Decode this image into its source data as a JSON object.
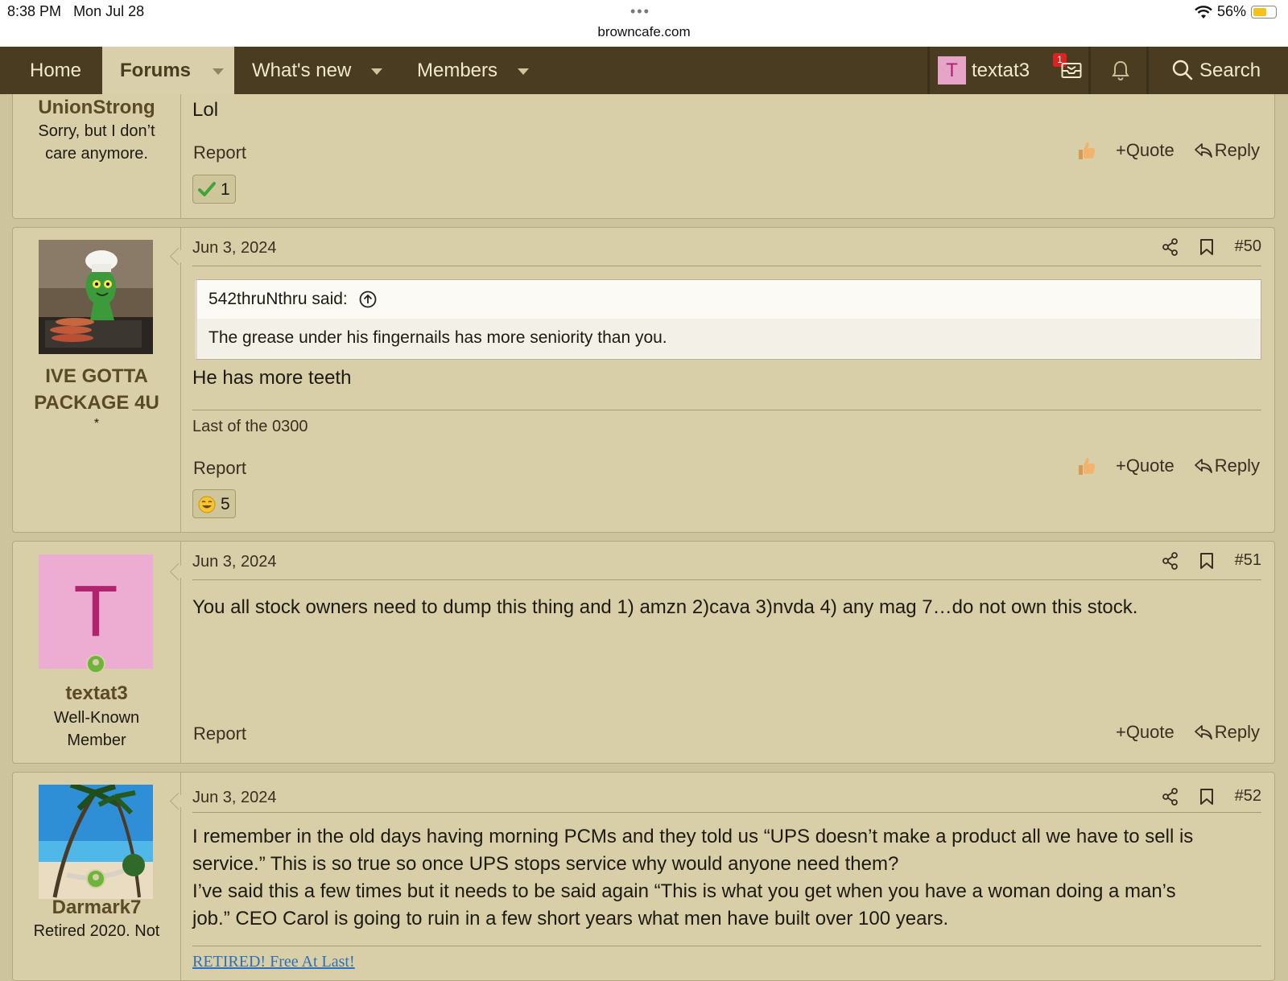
{
  "status_bar": {
    "time": "8:38 PM",
    "date": "Mon Jul 28",
    "url": "browncafe.com",
    "battery": "56%",
    "battery_level": 0.56
  },
  "nav": {
    "items": [
      {
        "label": "Home"
      },
      {
        "label": "Forums"
      },
      {
        "label": "What's new"
      },
      {
        "label": "Members"
      }
    ],
    "user_initial": "T",
    "username": "textat3",
    "inbox_badge": "1",
    "search_label": "Search"
  },
  "actions": {
    "report": "Report",
    "quote": "Quote",
    "reply": "Reply"
  },
  "posts": [
    {
      "username": "UnionStrong",
      "user_title": [
        "Sorry, but I don’t",
        "care anymore."
      ],
      "message": "Lol",
      "reaction": {
        "type": "check",
        "count": "1"
      }
    },
    {
      "username": [
        "IVE GOTTA",
        "PACKAGE 4U"
      ],
      "user_title_extra": "*",
      "date": "Jun 3, 2024",
      "number": "#50",
      "quote_author": "542thruNthru said:",
      "quote_text": "The grease under his fingernails has more seniority than you.",
      "message": "He has more teeth",
      "signature": "Last of the 0300",
      "reaction": {
        "type": "laugh",
        "count": "5"
      }
    },
    {
      "avatar_initial": "T",
      "username": "textat3",
      "user_title": [
        "Well-Known",
        "Member"
      ],
      "date": "Jun 3, 2024",
      "number": "#51",
      "message": "You all stock owners need to dump this thing and 1) amzn 2)cava 3)nvda 4) any mag 7…do not own this stock."
    },
    {
      "username": "Darmark7",
      "user_title": [
        "Retired 2020. Not"
      ],
      "date": "Jun 3, 2024",
      "number": "#52",
      "message_lines": [
        "I remember in the old days having morning PCMs and they told us “UPS doesn’t make a product all we have to sell is",
        "service.” This is so true so once UPS stops service why would anyone need them?",
        "I’ve said this a few times but it needs to be said again “This is what you get when you have a woman doing a man’s",
        "job.” CEO Carol is going to ruin in a few short years what men have built over 100 years."
      ],
      "signature": "RETIRED! Free At Last!"
    }
  ],
  "colors": {
    "nav_bg": "#4a3c20",
    "page_bg": "#cdc39c",
    "post_bg": "#d8cfa8",
    "username": "#5a4a26",
    "link": "#2f6fb5"
  }
}
